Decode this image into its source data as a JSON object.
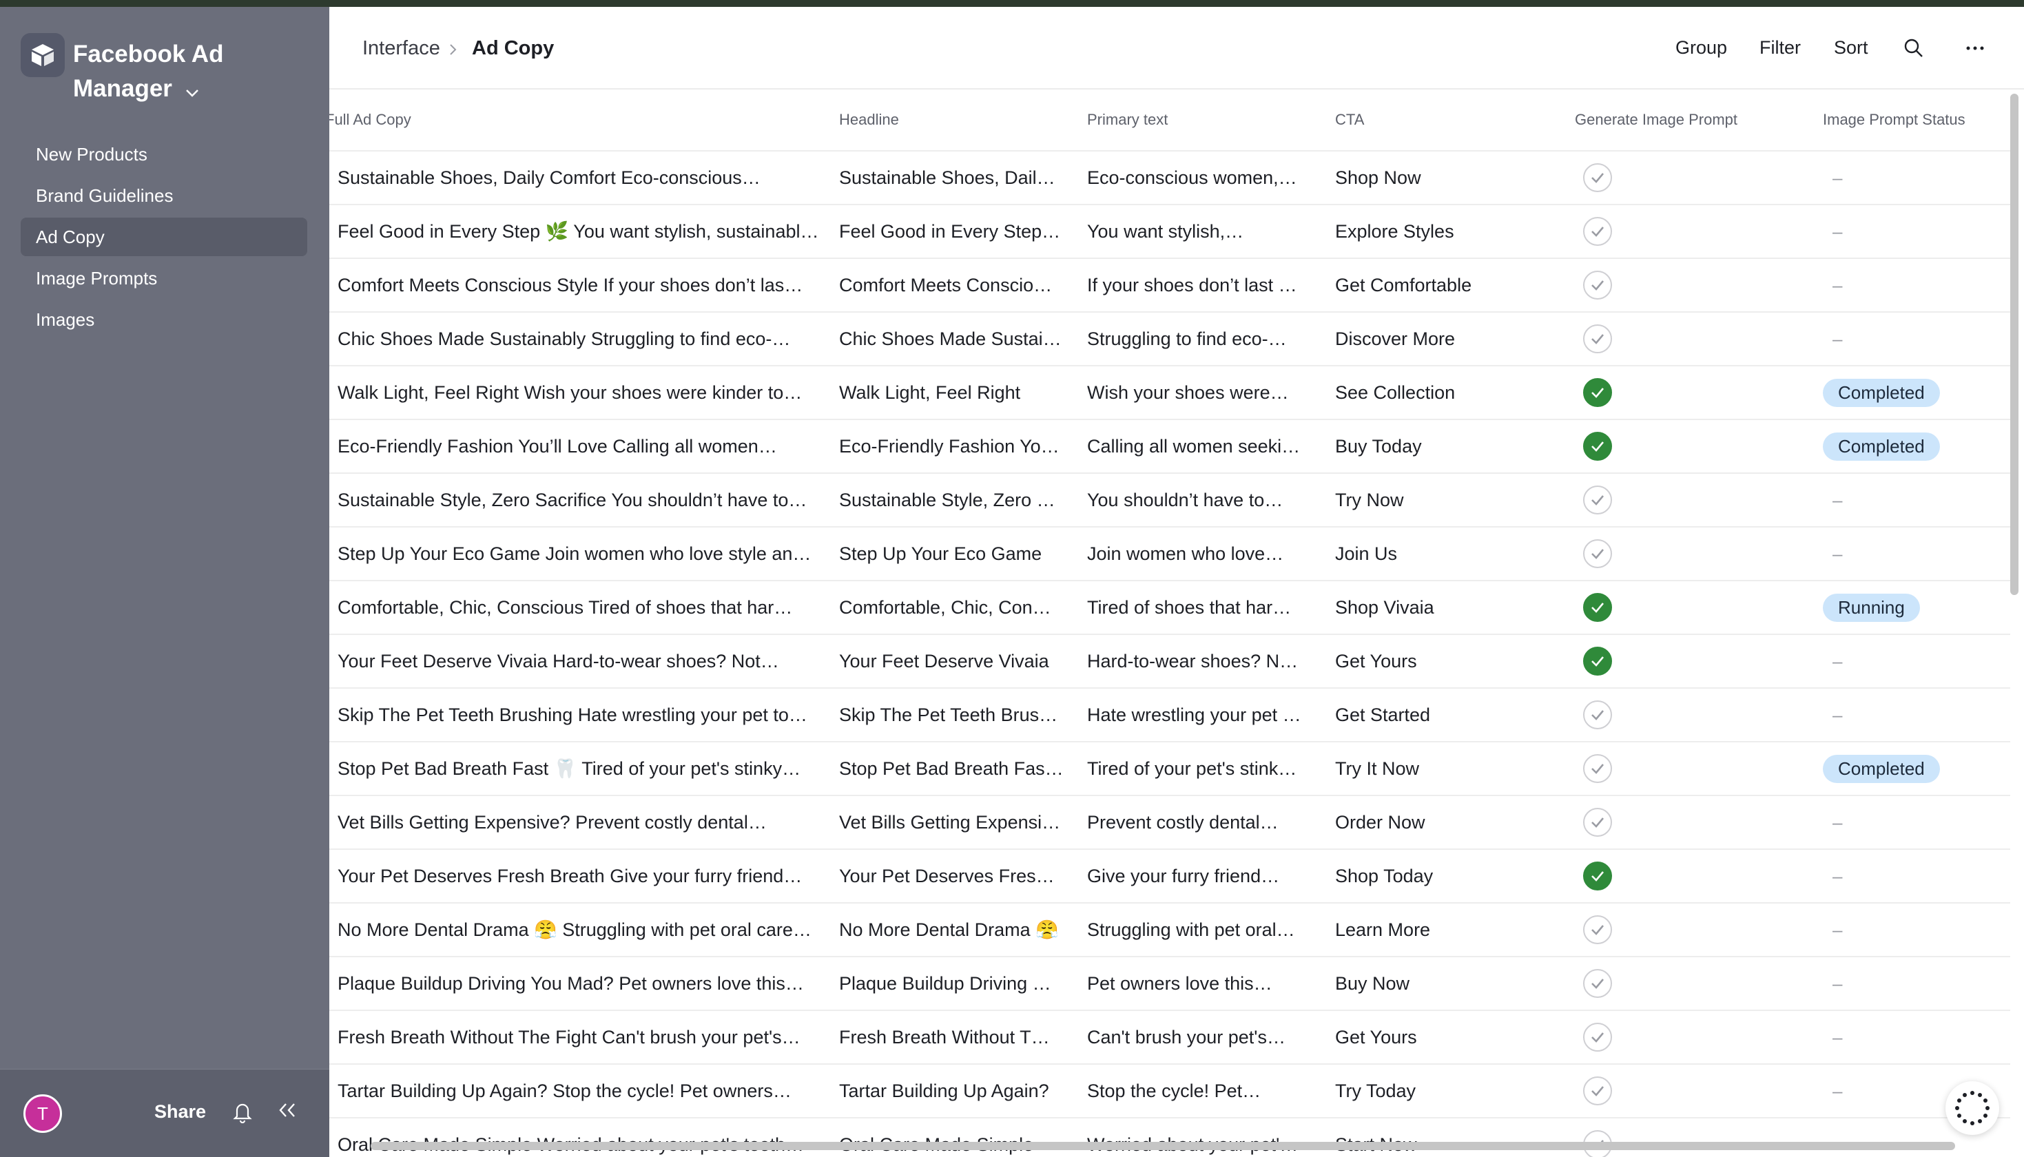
{
  "sidebar": {
    "base_name": "Facebook Ad Manager",
    "items": [
      {
        "label": "New Products"
      },
      {
        "label": "Brand Guidelines"
      },
      {
        "label": "Ad Copy",
        "active": true
      },
      {
        "label": "Image Prompts"
      },
      {
        "label": "Images"
      }
    ],
    "footer": {
      "avatar_initial": "T",
      "share_label": "Share"
    }
  },
  "header": {
    "breadcrumb": [
      "Interface",
      "Ad Copy"
    ],
    "actions": [
      "Group",
      "Filter",
      "Sort"
    ]
  },
  "table": {
    "columns": [
      "Full Ad Copy",
      "Headline",
      "Primary text",
      "CTA",
      "Generate Image Prompt",
      "Image Prompt Status"
    ],
    "rows": [
      {
        "full": "Sustainable Shoes, Daily Comfort Eco-conscious…",
        "headline": "Sustainable Shoes, Dail…",
        "primary": "Eco-conscious women,…",
        "cta": "Shop Now",
        "generate": false,
        "status": "–"
      },
      {
        "full": "Feel Good in Every Step 🌿 You want stylish, sustainabl…",
        "headline": "Feel Good in Every Step…",
        "primary": "You want stylish,…",
        "cta": "Explore Styles",
        "generate": false,
        "status": "–"
      },
      {
        "full": "Comfort Meets Conscious Style If your shoes don’t las…",
        "headline": "Comfort Meets Conscio…",
        "primary": "If your shoes don’t last …",
        "cta": "Get Comfortable",
        "generate": false,
        "status": "–"
      },
      {
        "full": "Chic Shoes Made Sustainably Struggling to find eco-…",
        "headline": "Chic Shoes Made Sustai…",
        "primary": "Struggling to find eco-…",
        "cta": "Discover More",
        "generate": false,
        "status": "–"
      },
      {
        "full": "Walk Light, Feel Right Wish your shoes were kinder to…",
        "headline": "Walk Light, Feel Right",
        "primary": "Wish your shoes were…",
        "cta": "See Collection",
        "generate": true,
        "status": "Completed"
      },
      {
        "full": "Eco-Friendly Fashion You’ll Love Calling all women…",
        "headline": "Eco-Friendly Fashion Yo…",
        "primary": "Calling all women seeki…",
        "cta": "Buy Today",
        "generate": true,
        "status": "Completed"
      },
      {
        "full": "Sustainable Style, Zero Sacrifice You shouldn’t have to…",
        "headline": "Sustainable Style, Zero …",
        "primary": "You shouldn’t have to…",
        "cta": "Try Now",
        "generate": false,
        "status": "–"
      },
      {
        "full": "Step Up Your Eco Game Join women who love style an…",
        "headline": "Step Up Your Eco Game",
        "primary": "Join women who love…",
        "cta": "Join Us",
        "generate": false,
        "status": "–"
      },
      {
        "full": "Comfortable, Chic, Conscious Tired of shoes that har…",
        "headline": "Comfortable, Chic, Con…",
        "primary": "Tired of shoes that har…",
        "cta": "Shop Vivaia",
        "generate": true,
        "status": "Running"
      },
      {
        "full": "Your Feet Deserve Vivaia Hard-to-wear shoes? Not…",
        "headline": "Your Feet Deserve Vivaia",
        "primary": "Hard-to-wear shoes? N…",
        "cta": "Get Yours",
        "generate": true,
        "status": "–"
      },
      {
        "full": "Skip The Pet Teeth Brushing Hate wrestling your pet to…",
        "headline": "Skip The Pet Teeth Brus…",
        "primary": "Hate wrestling your pet …",
        "cta": "Get Started",
        "generate": false,
        "status": "–"
      },
      {
        "full": "Stop Pet Bad Breath Fast 🦷 Tired of your pet's stinky…",
        "headline": "Stop Pet Bad Breath Fas…",
        "primary": "Tired of your pet's stink…",
        "cta": "Try It Now",
        "generate": false,
        "status": "Completed"
      },
      {
        "full": "Vet Bills Getting Expensive? Prevent costly dental…",
        "headline": "Vet Bills Getting Expensi…",
        "primary": "Prevent costly dental…",
        "cta": "Order Now",
        "generate": false,
        "status": "–"
      },
      {
        "full": "Your Pet Deserves Fresh Breath Give your furry friend…",
        "headline": "Your Pet Deserves Fres…",
        "primary": "Give your furry friend…",
        "cta": "Shop Today",
        "generate": true,
        "status": "–"
      },
      {
        "full": "No More Dental Drama 😤 Struggling with pet oral care…",
        "headline": "No More Dental Drama 😤",
        "primary": "Struggling with pet oral…",
        "cta": "Learn More",
        "generate": false,
        "status": "–"
      },
      {
        "full": "Plaque Buildup Driving You Mad? Pet owners love this…",
        "headline": "Plaque Buildup Driving …",
        "primary": "Pet owners love this…",
        "cta": "Buy Now",
        "generate": false,
        "status": "–"
      },
      {
        "full": "Fresh Breath Without The Fight Can't brush your pet's…",
        "headline": "Fresh Breath Without T…",
        "primary": "Can't brush your pet's…",
        "cta": "Get Yours",
        "generate": false,
        "status": "–"
      },
      {
        "full": "Tartar Building Up Again? Stop the cycle! Pet owners…",
        "headline": "Tartar Building Up Again?",
        "primary": "Stop the cycle! Pet…",
        "cta": "Try Today",
        "generate": false,
        "status": "–"
      },
      {
        "full": "Oral Care Made Simple Worried about your pet's teeth…",
        "headline": "Oral Care Made Simple",
        "primary": "Worried about your pet'…",
        "cta": "Start Now",
        "generate": false,
        "status": ""
      }
    ]
  },
  "colors": {
    "sidebar_bg": "#6b6e7b",
    "active_nav_bg": "#595c69",
    "check_green": "#2f8a3a",
    "status_pill_bg": "#cce5fb",
    "avatar_bg": "#c62f9a"
  },
  "icons": [
    "base-logo-icon",
    "chevron-down-icon",
    "chevron-right-icon",
    "search-icon",
    "more-icon",
    "bell-icon",
    "collapse-icon",
    "check-icon",
    "loading-spinner-icon"
  ]
}
